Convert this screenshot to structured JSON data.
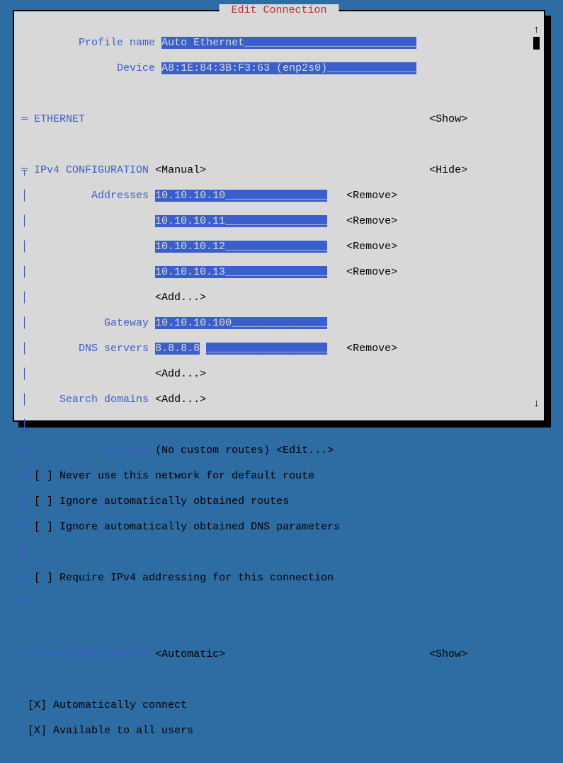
{
  "title": " Edit Connection ",
  "labels": {
    "profile_name": "Profile name",
    "device": "Device",
    "ethernet": "ETHERNET",
    "ipv4": "IPv4 CONFIGURATION",
    "addresses": "Addresses",
    "gateway": "Gateway",
    "dns": "DNS servers",
    "search": "Search domains",
    "routing": "Routing",
    "routing_status": "(No custom routes)",
    "ipv6": "IPv6 CONFIGURATION"
  },
  "values": {
    "profile_name": "Auto Ethernet",
    "device": "A8:1E:84:3B:F3:63 (enp2s0)",
    "ipv4_mode": "<Manual>",
    "addresses": [
      "10.10.10.10",
      "10.10.10.11",
      "10.10.10.12",
      "10.10.10.13"
    ],
    "gateway": "10.10.10.100",
    "dns": "8.8.8.8",
    "ipv6_mode": "<Automatic>"
  },
  "buttons": {
    "show": "<Show>",
    "hide": "<Hide>",
    "remove": "<Remove>",
    "add": "<Add...>",
    "edit": "<Edit...>"
  },
  "checkboxes": {
    "never_default": "[ ] Never use this network for default route",
    "ignore_routes": "[ ] Ignore automatically obtained routes",
    "ignore_dns": "[ ] Ignore automatically obtained DNS parameters",
    "require_ipv4": "[ ] Require IPv4 addressing for this connection",
    "auto_connect": "[X] Automatically connect",
    "all_users": "[X] Available to all users"
  },
  "glyph": {
    "tree_eq": "═",
    "tree_top": "╤",
    "tree_bar": "│",
    "tree_end": "╘"
  }
}
